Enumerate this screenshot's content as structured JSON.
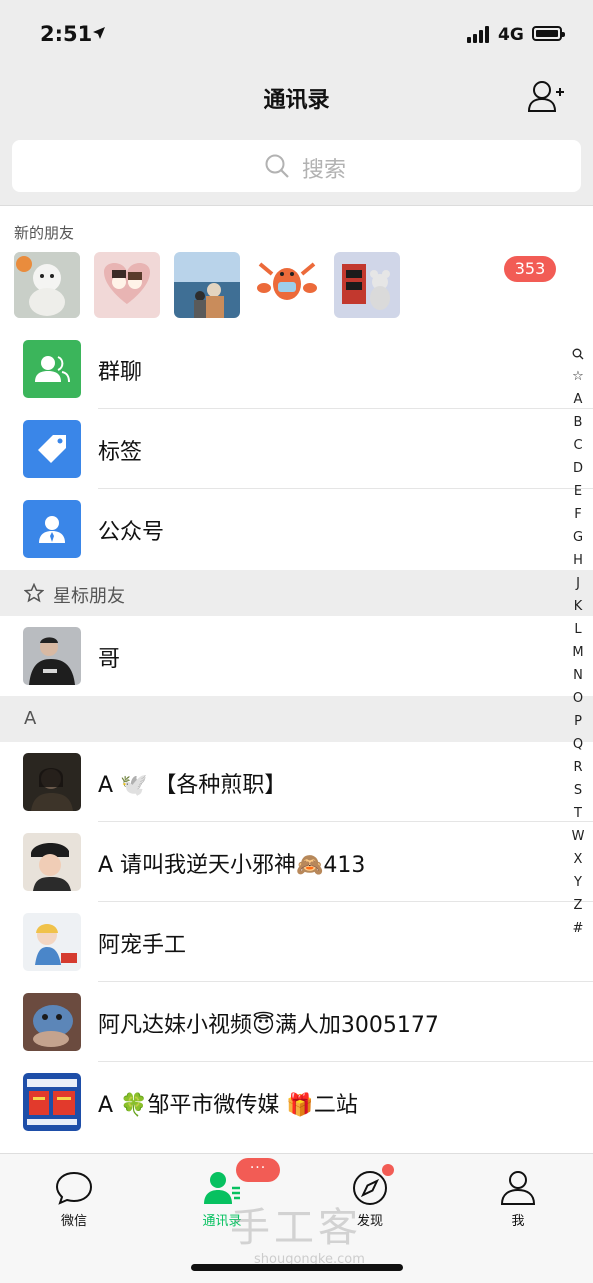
{
  "status_bar": {
    "time": "2:51",
    "network": "4G"
  },
  "nav": {
    "title": "通讯录"
  },
  "search": {
    "placeholder": "搜索"
  },
  "new_friends": {
    "label": "新的朋友",
    "badge": "353"
  },
  "functions": [
    {
      "label": "群聊",
      "icon": "group-chat-icon",
      "color": "#3bb55b"
    },
    {
      "label": "标签",
      "icon": "tag-icon",
      "color": "#3a86e8"
    },
    {
      "label": "公众号",
      "icon": "official-account-icon",
      "color": "#3a86e8"
    }
  ],
  "starred": {
    "header": "星标朋友",
    "contacts": [
      {
        "name": "哥"
      }
    ]
  },
  "section_a": {
    "header": "A",
    "contacts": [
      {
        "name": "A 🕊️ 【各种煎职】"
      },
      {
        "name": "A 请叫我逆天小邪神🙈413"
      },
      {
        "name": "阿宠手工"
      },
      {
        "name": "阿凡达妹小视频😇满人加3005177"
      },
      {
        "name": "A 🍀邹平市微传媒 🎁二站"
      }
    ]
  },
  "index_letters": [
    "Q",
    "☆",
    "A",
    "B",
    "C",
    "D",
    "E",
    "F",
    "G",
    "H",
    "J",
    "K",
    "L",
    "M",
    "N",
    "O",
    "P",
    "Q",
    "R",
    "S",
    "T",
    "W",
    "X",
    "Y",
    "Z",
    "#"
  ],
  "tabs": [
    {
      "label": "微信",
      "icon": "chat-bubble-icon"
    },
    {
      "label": "通讯录",
      "icon": "contacts-icon",
      "active": true,
      "badge": "···"
    },
    {
      "label": "发现",
      "icon": "compass-icon",
      "dot": true
    },
    {
      "label": "我",
      "icon": "person-icon"
    }
  ],
  "watermark": {
    "text": "手工客",
    "sub": "shougongke.com"
  },
  "colors": {
    "accent": "#07c160",
    "badge": "#f25c55",
    "background": "#ededed"
  }
}
